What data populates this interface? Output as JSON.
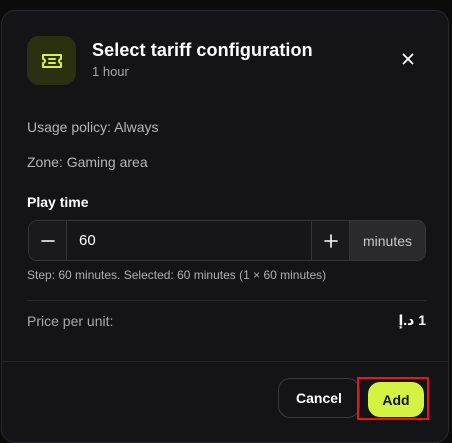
{
  "dialog": {
    "title": "Select tariff configuration",
    "subtitle": "1 hour",
    "icon": "ticket-icon",
    "accent_color": "#d3f342"
  },
  "info": {
    "usage_policy": "Usage policy: Always",
    "zone": "Zone: Gaming area"
  },
  "play_time": {
    "label": "Play time",
    "value": "60",
    "unit": "minutes",
    "hint": "Step: 60 minutes. Selected: 60 minutes (1 × 60 minutes)"
  },
  "price": {
    "label": "Price per unit:",
    "value": "1 د.إ"
  },
  "footer": {
    "cancel_label": "Cancel",
    "add_label": "Add"
  }
}
